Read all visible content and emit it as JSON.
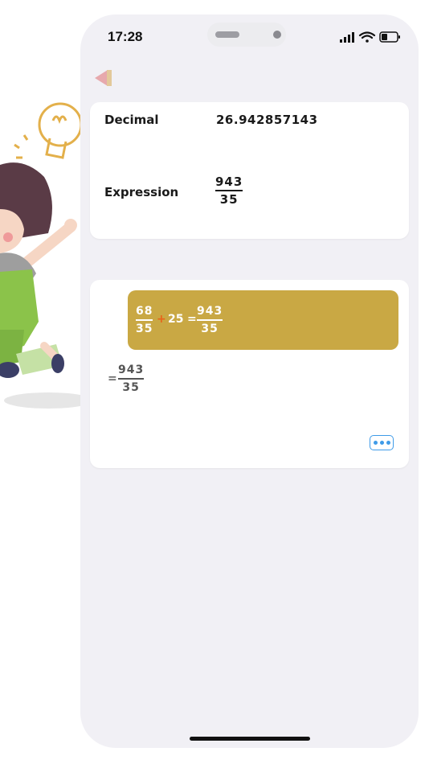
{
  "status_bar": {
    "time": "17:28"
  },
  "result_card": {
    "decimal_label": "Decimal",
    "decimal_value": "26.942857143",
    "expression_label": "Expression",
    "expression_numerator": "943",
    "expression_denominator": "35"
  },
  "steps_card": {
    "step1": {
      "frac_a_num": "68",
      "frac_a_den": "35",
      "plus": "+",
      "whole": "25",
      "equals": "=",
      "frac_b_num": "943",
      "frac_b_den": "35"
    },
    "step2": {
      "equals": "=",
      "num": "943",
      "den": "35"
    }
  },
  "colors": {
    "highlight_bg": "#c9a844",
    "plus_sign": "#e8631a",
    "more_button": "#3f9be8",
    "back_arrow": "#e7a9ad"
  },
  "icons": {
    "back": "back-arrow-icon",
    "more": "more-dots-icon",
    "signal": "signal-icon",
    "wifi": "wifi-icon",
    "battery": "battery-icon"
  }
}
